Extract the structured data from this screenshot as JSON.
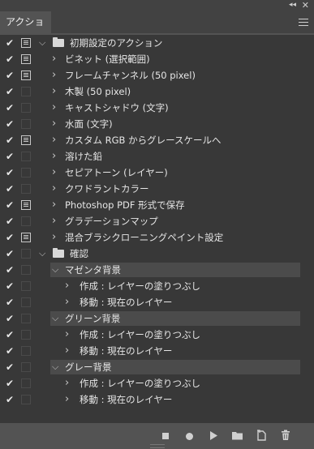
{
  "panel": {
    "tab_label": "アクション",
    "collapse_glyph": "◂◂",
    "close_glyph": "✕",
    "menu_icon": "hamburger-menu-icon"
  },
  "rows": [
    {
      "indent": 0,
      "type": "set",
      "dialog": true,
      "label": "初期設定のアクション"
    },
    {
      "indent": 1,
      "type": "action",
      "dialog": true,
      "label": "ビネット (選択範囲)"
    },
    {
      "indent": 1,
      "type": "action",
      "dialog": true,
      "label": "フレームチャンネル (50 pixel)"
    },
    {
      "indent": 1,
      "type": "action",
      "dialog": false,
      "label": "木製 (50 pixel)"
    },
    {
      "indent": 1,
      "type": "action",
      "dialog": false,
      "label": "キャストシャドウ (文字)"
    },
    {
      "indent": 1,
      "type": "action",
      "dialog": false,
      "label": "水面 (文字)"
    },
    {
      "indent": 1,
      "type": "action",
      "dialog": true,
      "label": "カスタム RGB からグレースケールへ"
    },
    {
      "indent": 1,
      "type": "action",
      "dialog": false,
      "label": "溶けた鉛"
    },
    {
      "indent": 1,
      "type": "action",
      "dialog": false,
      "label": "セピアトーン (レイヤー)"
    },
    {
      "indent": 1,
      "type": "action",
      "dialog": false,
      "label": "クワドラントカラー"
    },
    {
      "indent": 1,
      "type": "action",
      "dialog": true,
      "label": "Photoshop PDF 形式で保存"
    },
    {
      "indent": 1,
      "type": "action",
      "dialog": false,
      "label": "グラデーションマップ"
    },
    {
      "indent": 1,
      "type": "action",
      "dialog": true,
      "label": "混合ブラシクローニングペイント設定"
    },
    {
      "indent": 0,
      "type": "set",
      "dialog": false,
      "label": "確認"
    },
    {
      "indent": 1,
      "type": "group",
      "dialog": false,
      "label": "マゼンタ背景"
    },
    {
      "indent": 2,
      "type": "step",
      "dialog": false,
      "label": "作成 : レイヤーの塗りつぶし"
    },
    {
      "indent": 2,
      "type": "step",
      "dialog": false,
      "label": "移動 : 現在のレイヤー"
    },
    {
      "indent": 1,
      "type": "group",
      "dialog": false,
      "label": "グリーン背景"
    },
    {
      "indent": 2,
      "type": "step",
      "dialog": false,
      "label": "作成 : レイヤーの塗りつぶし"
    },
    {
      "indent": 2,
      "type": "step",
      "dialog": false,
      "label": "移動 : 現在のレイヤー"
    },
    {
      "indent": 1,
      "type": "group",
      "dialog": false,
      "label": "グレー背景"
    },
    {
      "indent": 2,
      "type": "step",
      "dialog": false,
      "label": "作成 : レイヤーの塗りつぶし"
    },
    {
      "indent": 2,
      "type": "step",
      "dialog": false,
      "label": "移動 : 現在のレイヤー"
    }
  ],
  "toolbar": {
    "icons": [
      "stop-icon",
      "record-icon",
      "play-icon",
      "new-set-folder-icon",
      "new-action-icon",
      "delete-trash-icon"
    ]
  },
  "colors": {
    "panel_bg": "#535353",
    "list_bg": "#383838",
    "highlight_bg": "#4b4b4b",
    "text": "#e6e6e6"
  }
}
